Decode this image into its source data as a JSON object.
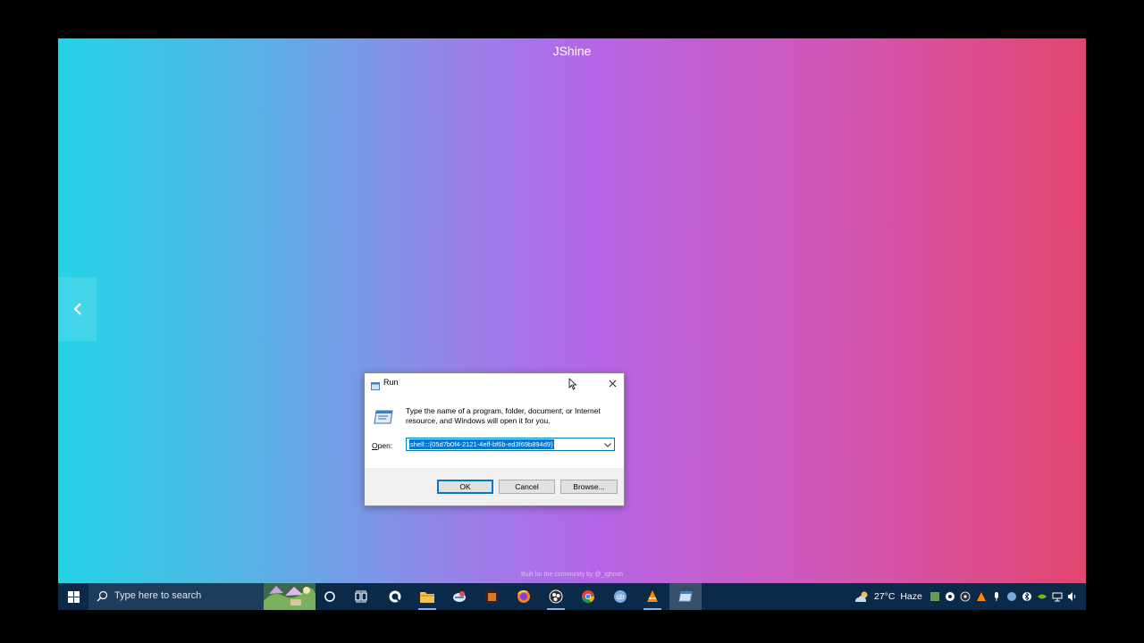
{
  "desktop": {
    "title": "JShine",
    "footer_note": "Built for the community by @_ighosh"
  },
  "run_dialog": {
    "title": "Run",
    "description": "Type the name of a program, folder, document, or Internet resource, and Windows will open it for you.",
    "open_label_underlined": "O",
    "open_label_rest": "pen:",
    "open_value": "shell:::{05d7b0f4-2121-4eff-bf6b-ed3f69b894d9}",
    "ok_label": "OK",
    "cancel_label": "Cancel",
    "browse_label": "Browse..."
  },
  "taskbar": {
    "search_placeholder": "Type here to search",
    "temperature": "27°C",
    "weather": "Haze",
    "pinned_icons": [
      "cortana-icon",
      "task-view-icon",
      "quickshare-icon",
      "file-explorer-icon",
      "network-app-icon",
      "calculator-app-icon",
      "firefox-icon",
      "obs-icon",
      "chrome-icon",
      "qbittorrent-icon",
      "vlc-icon",
      "run-app-icon"
    ]
  },
  "colors": {
    "accent": "#0078d7",
    "taskbar": "#0b2a4a",
    "gradient_left": "#23d3e6",
    "gradient_mid": "#b566e6",
    "gradient_right": "#e3456e"
  }
}
